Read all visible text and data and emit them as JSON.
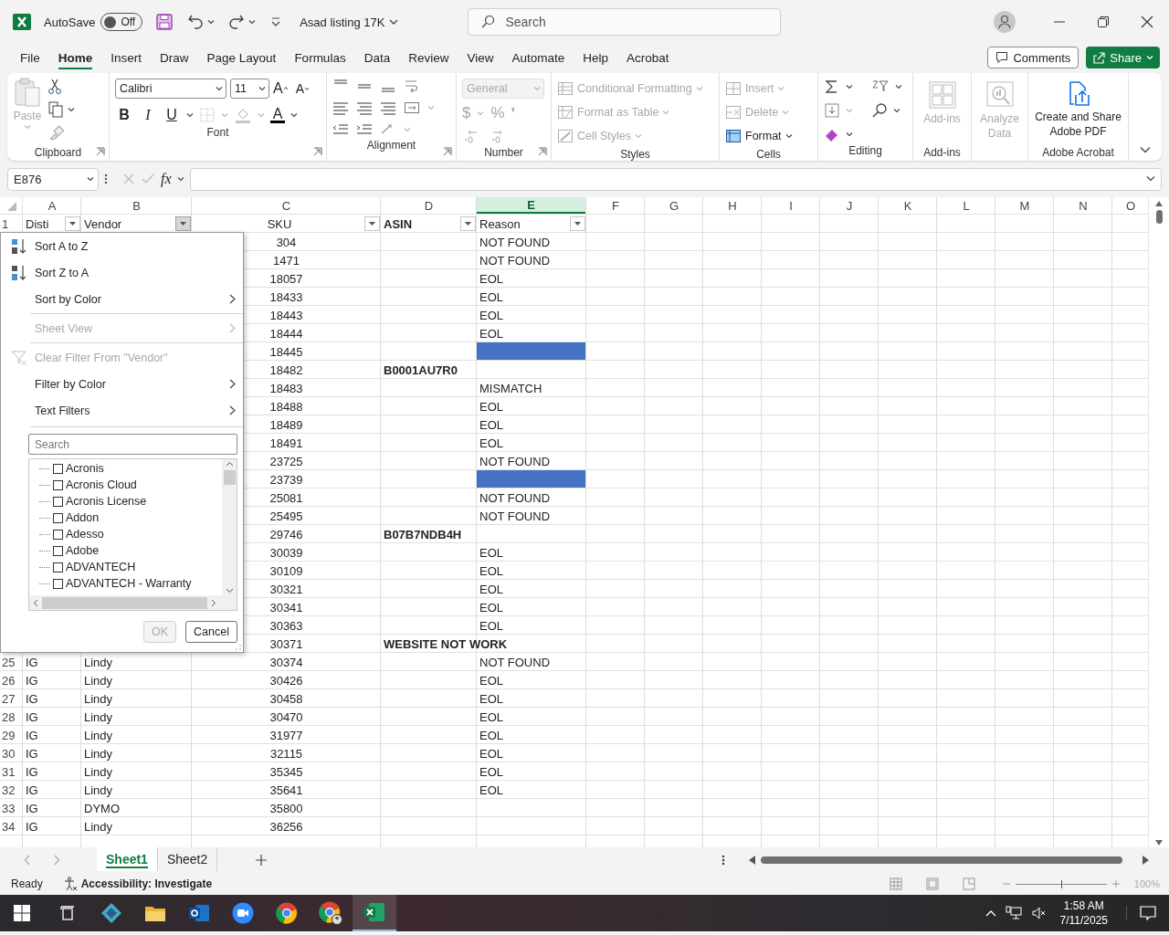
{
  "title_bar": {
    "autosave_label": "AutoSave",
    "autosave": {
      "on": false,
      "label": "Off"
    },
    "document_title": "Asad listing 17K",
    "search": {
      "placeholder": "Search"
    }
  },
  "menu_tabs": [
    {
      "label": "File",
      "selected": false
    },
    {
      "label": "Home",
      "selected": true
    },
    {
      "label": "Insert",
      "selected": false
    },
    {
      "label": "Draw",
      "selected": false
    },
    {
      "label": "Page Layout",
      "selected": false
    },
    {
      "label": "Formulas",
      "selected": false
    },
    {
      "label": "Data",
      "selected": false
    },
    {
      "label": "Review",
      "selected": false
    },
    {
      "label": "View",
      "selected": false
    },
    {
      "label": "Automate",
      "selected": false
    },
    {
      "label": "Help",
      "selected": false
    },
    {
      "label": "Acrobat",
      "selected": false
    }
  ],
  "comments_button": "Comments",
  "share_button": "Share",
  "ribbon": {
    "groups": [
      {
        "kind": "clipboard",
        "label": "Clipboard",
        "launcher": true,
        "paste": {
          "label": "Paste",
          "disabled": true
        }
      },
      {
        "kind": "font",
        "label": "Font",
        "launcher": true,
        "font": "Calibri",
        "size": "11",
        "grow": "A",
        "shrink": "A",
        "bold": "B",
        "italic": "I",
        "underline": "U",
        "font_color": "A"
      },
      {
        "kind": "alignment",
        "label": "Alignment",
        "launcher": true
      },
      {
        "kind": "number",
        "label": "Number",
        "launcher": true,
        "format": {
          "value": "General",
          "disabled": true
        },
        "currency": "$",
        "percent": "%",
        "comma": "❜"
      },
      {
        "kind": "styles",
        "label": "Styles",
        "launcher": false,
        "items": [
          {
            "kind": "conditional",
            "label": "Conditional Formatting",
            "disabled": true
          },
          {
            "kind": "table",
            "label": "Format as Table",
            "disabled": true
          },
          {
            "kind": "cell-styles",
            "label": "Cell Styles",
            "disabled": true
          }
        ]
      },
      {
        "kind": "cells",
        "label": "Cells",
        "launcher": false,
        "items": [
          {
            "kind": "insert",
            "label": "Insert",
            "disabled": true
          },
          {
            "kind": "delete",
            "label": "Delete",
            "disabled": true
          },
          {
            "kind": "format",
            "label": "Format",
            "disabled": false
          }
        ]
      },
      {
        "kind": "editing",
        "label": "Editing",
        "launcher": false
      },
      {
        "kind": "addins",
        "label": "Add-ins",
        "launcher": false,
        "button": {
          "label": "Add-ins",
          "disabled": true
        }
      },
      {
        "kind": "analyze",
        "launcher": false,
        "button": {
          "label": "Analyze Data",
          "disabled": true
        }
      },
      {
        "kind": "acrobat",
        "label": "Adobe Acrobat",
        "launcher": false,
        "button": {
          "label": "Create and Share Adobe PDF",
          "disabled": false
        }
      }
    ]
  },
  "formula_bar": {
    "name_box": "E876",
    "fx": "fx"
  },
  "table": {
    "columns": [
      {
        "letter": "A",
        "selected": false
      },
      {
        "letter": "B",
        "selected": false
      },
      {
        "letter": "C",
        "selected": false
      },
      {
        "letter": "D",
        "selected": false
      },
      {
        "letter": "E",
        "selected": true
      },
      {
        "letter": "F",
        "selected": false
      },
      {
        "letter": "G",
        "selected": false
      },
      {
        "letter": "H",
        "selected": false
      },
      {
        "letter": "I",
        "selected": false
      },
      {
        "letter": "J",
        "selected": false
      },
      {
        "letter": "K",
        "selected": false
      },
      {
        "letter": "L",
        "selected": false
      },
      {
        "letter": "M",
        "selected": false
      },
      {
        "letter": "N",
        "selected": false
      },
      {
        "letter": "O",
        "selected": false
      }
    ],
    "header_row": {
      "n": "1",
      "cells": [
        {
          "text": "Disti",
          "open": false
        },
        {
          "text": "Vendor",
          "open": true
        },
        {
          "text": "SKU",
          "open": false
        },
        {
          "text": "ASIN",
          "open": false
        },
        {
          "text": "Reason",
          "open": false
        }
      ]
    },
    "rows": [
      {
        "sku": "304",
        "reason": "NOT FOUND"
      },
      {
        "sku": "1471",
        "reason": "NOT FOUND"
      },
      {
        "sku": "18057",
        "reason": "EOL"
      },
      {
        "sku": "18433",
        "reason": "EOL"
      },
      {
        "sku": "18443",
        "reason": "EOL"
      },
      {
        "sku": "18444",
        "reason": "EOL"
      },
      {
        "sku": "18445",
        "color": "#4472c4"
      },
      {
        "sku": "18482",
        "asin": "B0001AU7R0"
      },
      {
        "sku": "18483",
        "reason": "MISMATCH"
      },
      {
        "sku": "18488",
        "reason": "EOL"
      },
      {
        "sku": "18489",
        "reason": "EOL"
      },
      {
        "sku": "18491",
        "reason": "EOL"
      },
      {
        "sku": "23725",
        "reason": "NOT FOUND"
      },
      {
        "sku": "23739",
        "color": "#4472c4"
      },
      {
        "sku": "25081",
        "reason": "NOT FOUND"
      },
      {
        "sku": "25495",
        "reason": "NOT FOUND"
      },
      {
        "sku": "29746",
        "asin": "B07B7NDB4H"
      },
      {
        "sku": "30039",
        "reason": "EOL"
      },
      {
        "sku": "30109",
        "reason": "EOL"
      },
      {
        "sku": "30321",
        "reason": "EOL"
      },
      {
        "sku": "30341",
        "reason": "EOL"
      },
      {
        "sku": "30363",
        "reason": "EOL"
      },
      {
        "sku": "30371",
        "asin": "WEBSITE NOT WORK"
      },
      {
        "n": "25",
        "disti": "IG",
        "vendor": "Lindy",
        "sku": "30374",
        "reason": "NOT FOUND"
      },
      {
        "n": "26",
        "disti": "IG",
        "vendor": "Lindy",
        "sku": "30426",
        "reason": "EOL"
      },
      {
        "n": "27",
        "disti": "IG",
        "vendor": "Lindy",
        "sku": "30458",
        "reason": "EOL"
      },
      {
        "n": "28",
        "disti": "IG",
        "vendor": "Lindy",
        "sku": "30470",
        "reason": "EOL"
      },
      {
        "n": "29",
        "disti": "IG",
        "vendor": "Lindy",
        "sku": "31977",
        "reason": "EOL"
      },
      {
        "n": "30",
        "disti": "IG",
        "vendor": "Lindy",
        "sku": "32115",
        "reason": "EOL"
      },
      {
        "n": "31",
        "disti": "IG",
        "vendor": "Lindy",
        "sku": "35345",
        "reason": "EOL"
      },
      {
        "n": "32",
        "disti": "IG",
        "vendor": "Lindy",
        "sku": "35641",
        "reason": "EOL"
      },
      {
        "n": "33",
        "disti": "IG",
        "vendor": "DYMO",
        "sku": "35800"
      },
      {
        "n": "34",
        "disti": "IG",
        "vendor": "Lindy",
        "sku": "36256"
      }
    ]
  },
  "filter_menu": {
    "items": [
      {
        "kind": "sort-az",
        "label": "Sort A to Z",
        "disabled": false,
        "submenu": false
      },
      {
        "kind": "sort-za",
        "label": "Sort Z to A",
        "disabled": false,
        "submenu": false
      },
      {
        "kind": "plain",
        "label": "Sort by Color",
        "disabled": false,
        "submenu": true
      },
      {
        "kind": "divider"
      },
      {
        "kind": "plain",
        "label": "Sheet View",
        "disabled": true,
        "submenu": true
      },
      {
        "kind": "divider"
      },
      {
        "kind": "clear",
        "label": "Clear Filter From \"Vendor\"",
        "disabled": true,
        "submenu": false
      },
      {
        "kind": "plain",
        "label": "Filter by Color",
        "disabled": false,
        "submenu": true
      },
      {
        "kind": "plain",
        "label": "Text Filters",
        "disabled": false,
        "submenu": true
      }
    ],
    "search": {
      "placeholder": "Search"
    },
    "values": [
      {
        "label": "Acronis",
        "checked": false
      },
      {
        "label": "Acronis Cloud",
        "checked": false
      },
      {
        "label": "Acronis License",
        "checked": false
      },
      {
        "label": "Addon",
        "checked": false
      },
      {
        "label": "Adesso",
        "checked": false
      },
      {
        "label": "Adobe",
        "checked": false
      },
      {
        "label": "ADVANTECH",
        "checked": false
      },
      {
        "label": "ADVANTECH - Warranty",
        "checked": false
      }
    ],
    "ok": {
      "label": "OK",
      "disabled": true
    },
    "cancel": {
      "label": "Cancel",
      "disabled": false
    }
  },
  "sheet_tabs": [
    {
      "label": "Sheet1",
      "selected": true
    },
    {
      "label": "Sheet2",
      "selected": false
    }
  ],
  "status_bar": {
    "ready": "Ready",
    "accessibility": "Accessibility: Investigate",
    "zoom": {
      "level": 0.5,
      "label": "100%"
    }
  },
  "taskbar": {
    "apps": [
      {
        "kind": "diamond",
        "selected": false
      },
      {
        "kind": "folder",
        "selected": false
      },
      {
        "kind": "mail",
        "selected": false
      },
      {
        "kind": "video",
        "selected": false
      },
      {
        "kind": "browser",
        "selected": false
      },
      {
        "kind": "browser-profile",
        "selected": false
      },
      {
        "kind": "sheet",
        "selected": true
      }
    ],
    "time": "1:58 AM",
    "date": "7/11/2025"
  }
}
